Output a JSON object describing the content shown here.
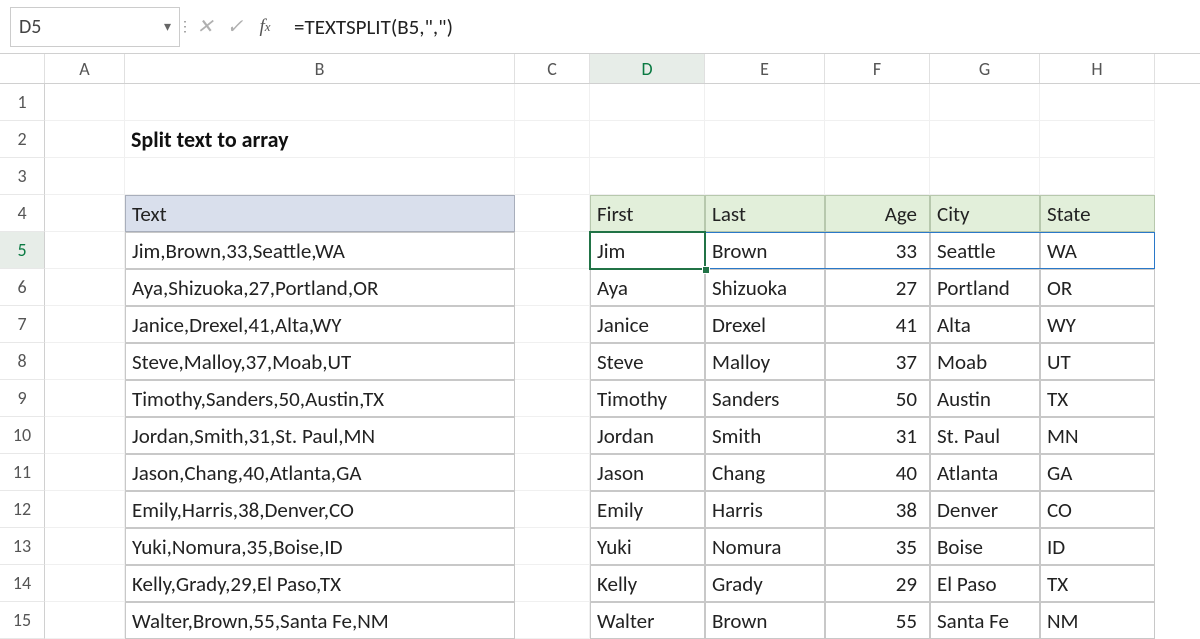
{
  "namebox": "D5",
  "formula": "=TEXTSPLIT(B5,\",\")",
  "title": "Split text to array",
  "columns": [
    "A",
    "B",
    "C",
    "D",
    "E",
    "F",
    "G",
    "H"
  ],
  "active_col": "D",
  "rows": [
    "1",
    "2",
    "3",
    "4",
    "5",
    "6",
    "7",
    "8",
    "9",
    "10",
    "11",
    "12",
    "13",
    "14",
    "15"
  ],
  "active_row": "5",
  "text_header": "Text",
  "split_headers": [
    "First",
    "Last",
    "Age",
    "City",
    "State"
  ],
  "data": [
    {
      "text": "Jim,Brown,33,Seattle,WA",
      "first": "Jim",
      "last": "Brown",
      "age": "33",
      "city": "Seattle",
      "state": "WA"
    },
    {
      "text": "Aya,Shizuoka,27,Portland,OR",
      "first": "Aya",
      "last": "Shizuoka",
      "age": "27",
      "city": "Portland",
      "state": "OR"
    },
    {
      "text": "Janice,Drexel,41,Alta,WY",
      "first": "Janice",
      "last": "Drexel",
      "age": "41",
      "city": "Alta",
      "state": "WY"
    },
    {
      "text": "Steve,Malloy,37,Moab,UT",
      "first": "Steve",
      "last": "Malloy",
      "age": "37",
      "city": "Moab",
      "state": "UT"
    },
    {
      "text": "Timothy,Sanders,50,Austin,TX",
      "first": "Timothy",
      "last": "Sanders",
      "age": "50",
      "city": "Austin",
      "state": "TX"
    },
    {
      "text": "Jordan,Smith,31,St. Paul,MN",
      "first": "Jordan",
      "last": "Smith",
      "age": "31",
      "city": "St. Paul",
      "state": "MN"
    },
    {
      "text": "Jason,Chang,40,Atlanta,GA",
      "first": "Jason",
      "last": "Chang",
      "age": "40",
      "city": "Atlanta",
      "state": "GA"
    },
    {
      "text": "Emily,Harris,38,Denver,CO",
      "first": "Emily",
      "last": "Harris",
      "age": "38",
      "city": "Denver",
      "state": "CO"
    },
    {
      "text": "Yuki,Nomura,35,Boise,ID",
      "first": "Yuki",
      "last": "Nomura",
      "age": "35",
      "city": "Boise",
      "state": "ID"
    },
    {
      "text": "Kelly,Grady,29,El Paso,TX",
      "first": "Kelly",
      "last": "Grady",
      "age": "29",
      "city": "El Paso",
      "state": "TX"
    },
    {
      "text": "Walter,Brown,55,Santa Fe,NM",
      "first": "Walter",
      "last": "Brown",
      "age": "55",
      "city": "Santa Fe",
      "state": "NM"
    }
  ]
}
